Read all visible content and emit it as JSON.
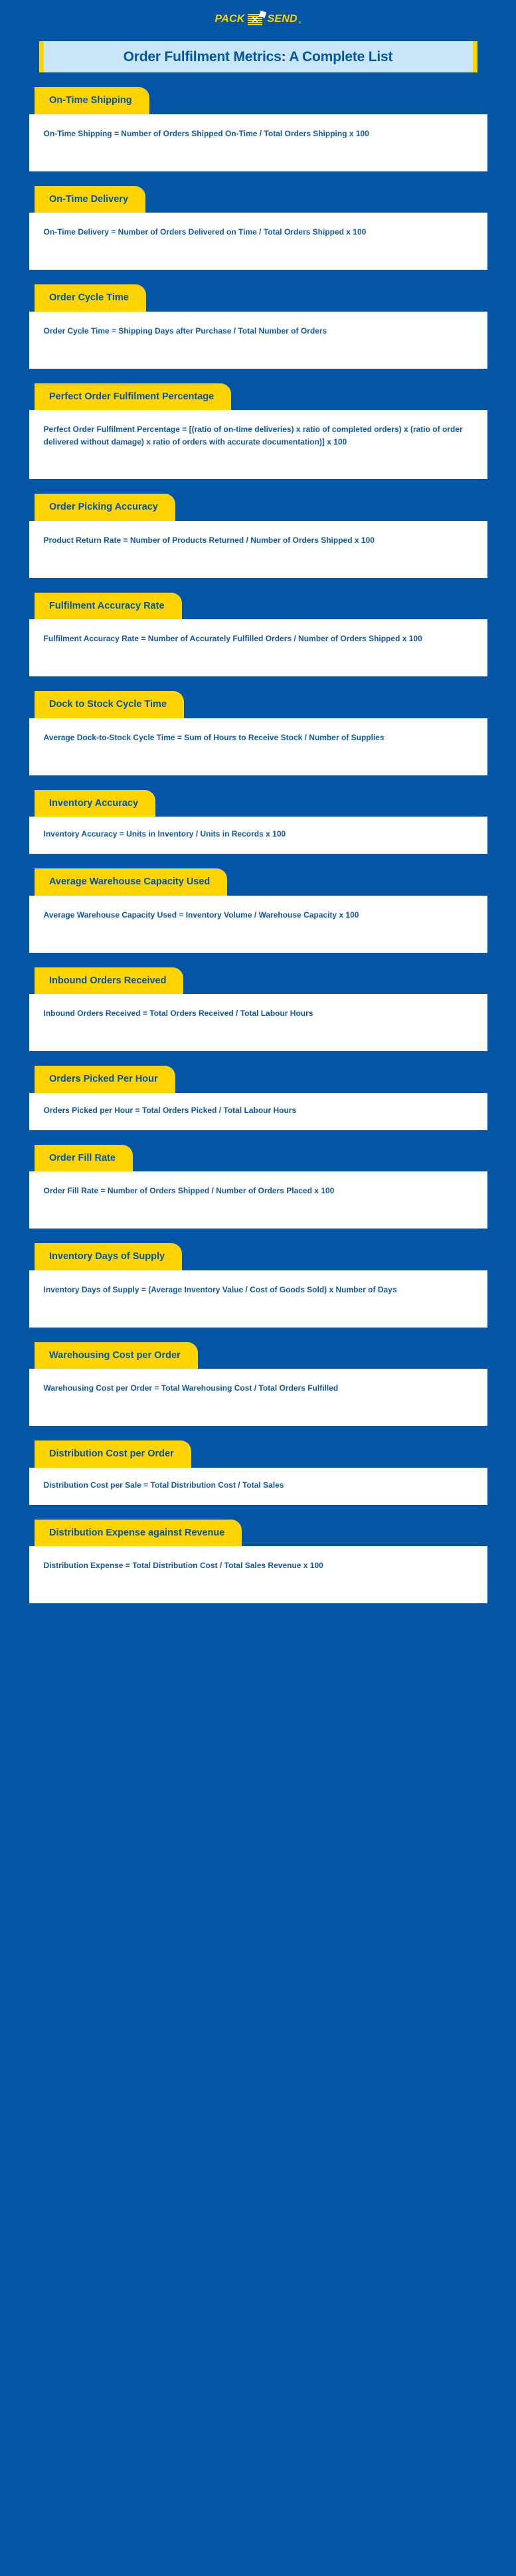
{
  "brand": {
    "logo_text_left": "PACK",
    "logo_text_right": "SEND",
    "logo_mark_glyph": "✕",
    "logo_trademark": "®",
    "background_color": "#0455a4",
    "accent_yellow": "#ffd400",
    "banner_blue": "#c8e6f7",
    "text_blue": "#0455a4"
  },
  "header": {
    "title": "Order Fulfilment Metrics: A Complete List"
  },
  "metrics": [
    {
      "title": "On-Time Shipping",
      "formula": "On-Time Shipping = Number of Orders Shipped On-Time / Total Orders Shipping x 100",
      "lines": 2
    },
    {
      "title": "On-Time Delivery",
      "formula": "On-Time Delivery = Number of Orders Delivered on Time / Total Orders Shipped x 100",
      "lines": 2
    },
    {
      "title": "Order Cycle Time",
      "formula": "Order Cycle Time = Shipping Days after Purchase / Total Number of Orders",
      "lines": 2
    },
    {
      "title": "Perfect Order Fulfilment Percentage",
      "formula": "Perfect Order Fulfilment Percentage = [(ratio of on-time deliveries) x ratio of completed orders) x (ratio of order delivered without damage) x ratio of orders with accurate documentation)] x 100",
      "lines": 3
    },
    {
      "title": "Order Picking Accuracy",
      "formula": "Product Return Rate = Number of Products Returned / Number of Orders Shipped x 100",
      "lines": 2
    },
    {
      "title": "Fulfilment Accuracy Rate",
      "formula": "Fulfilment Accuracy Rate = Number of Accurately Fulfilled Orders / Number of Orders Shipped x 100",
      "lines": 2
    },
    {
      "title": "Dock to Stock Cycle Time",
      "formula": "Average Dock-to-Stock Cycle Time = Sum of Hours to Receive Stock / Number of Supplies",
      "lines": 2
    },
    {
      "title": "Inventory Accuracy",
      "formula": "Inventory Accuracy = Units in Inventory / Units in Records x 100",
      "lines": 1
    },
    {
      "title": "Average Warehouse Capacity Used",
      "formula": "Average Warehouse Capacity Used = Inventory Volume / Warehouse Capacity x 100",
      "lines": 2
    },
    {
      "title": "Inbound Orders Received",
      "formula": "Inbound Orders Received = Total Orders Received / Total Labour Hours",
      "lines": 2
    },
    {
      "title": "Orders Picked Per Hour",
      "formula": "Orders Picked per Hour = Total Orders Picked / Total Labour Hours",
      "lines": 1
    },
    {
      "title": "Order Fill Rate",
      "formula": "Order Fill Rate = Number of Orders Shipped / Number of Orders Placed x 100",
      "lines": 2
    },
    {
      "title": "Inventory Days of Supply",
      "formula": "Inventory Days of Supply = (Average Inventory Value / Cost of Goods Sold) x Number of Days",
      "lines": 2
    },
    {
      "title": "Warehousing Cost per Order",
      "formula": "Warehousing Cost per Order = Total Warehousing Cost / Total Orders Fulfilled",
      "lines": 2
    },
    {
      "title": "Distribution Cost per Order",
      "formula": "Distribution Cost per Sale = Total Distribution Cost / Total Sales",
      "lines": 1
    },
    {
      "title": "Distribution Expense against Revenue",
      "formula": "Distribution Expense = Total Distribution Cost / Total Sales Revenue x 100",
      "lines": 2
    }
  ]
}
